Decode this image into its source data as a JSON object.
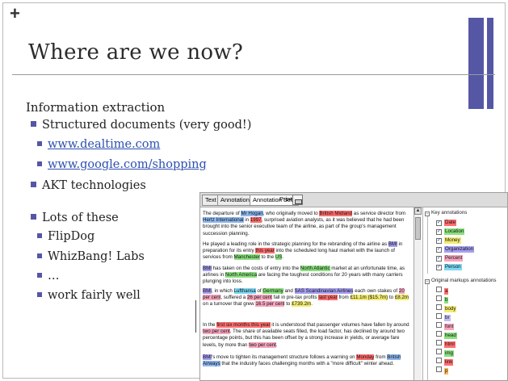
{
  "slide": {
    "plus": "+",
    "title": "Where are we now?",
    "section": "Information extraction",
    "accent_color": "#5557a5",
    "bullets": [
      {
        "text": "Structured documents (very good!)"
      },
      {
        "text": "www.dealtime.com",
        "link": true
      },
      {
        "text": "www.google.com/shopping",
        "link": true
      },
      {
        "text": "AKT technologies"
      },
      {
        "text": "Lots of these"
      },
      {
        "text": "FlipDog"
      },
      {
        "text": "WhizBang! Labs"
      },
      {
        "text": "…"
      },
      {
        "text": "work fairly well"
      }
    ]
  },
  "app": {
    "tabs": [
      "Text",
      "Annotations",
      "Annotation Sets",
      "Print"
    ],
    "printer_icon": "printer-icon",
    "paragraphs": [
      {
        "segments": [
          {
            "t": "The departure of "
          },
          {
            "t": "Mr Hogan",
            "c": "blue"
          },
          {
            "t": ", who originally moved to "
          },
          {
            "t": "British Midland",
            "c": "red"
          },
          {
            "t": " as service director from "
          },
          {
            "t": "Hertz International",
            "c": "blue"
          },
          {
            "t": " in "
          },
          {
            "t": "1997",
            "c": "red"
          },
          {
            "t": ", surprised aviation analysts, as it was believed that he had been brought into the senior executive team of the airline, as part of the group's management succession planning."
          }
        ]
      },
      {
        "segments": [
          {
            "t": "He played a leading role in the strategic planning for the rebranding of the airline as "
          },
          {
            "t": "BMI",
            "c": "violet"
          },
          {
            "t": " in preparation for its entry "
          },
          {
            "t": "this year",
            "c": "red"
          },
          {
            "t": " into the scheduled long haul market with the launch of services from "
          },
          {
            "t": "Manchester",
            "c": "green"
          },
          {
            "t": " to the "
          },
          {
            "t": "US",
            "c": "green"
          },
          {
            "t": "."
          }
        ]
      },
      {
        "segments": [
          {
            "t": "BMI",
            "c": "violet"
          },
          {
            "t": " has taken on the costs of entry into the "
          },
          {
            "t": "North Atlantic",
            "c": "green"
          },
          {
            "t": " market at an unfortunate time, as airlines in "
          },
          {
            "t": "North America",
            "c": "green"
          },
          {
            "t": " are facing the toughest conditions for 20 years with many carriers plunging into loss."
          }
        ]
      },
      {
        "segments": [
          {
            "t": "BMI",
            "c": "violet"
          },
          {
            "t": ", in which "
          },
          {
            "t": "Lufthansa",
            "c": "cyan"
          },
          {
            "t": " of "
          },
          {
            "t": "Germany",
            "c": "green"
          },
          {
            "t": " and "
          },
          {
            "t": "SAS Scandinavian Airlines",
            "c": "violet"
          },
          {
            "t": " each own stakes of "
          },
          {
            "t": "20 per cent",
            "c": "pink"
          },
          {
            "t": ", suffered a "
          },
          {
            "t": "26 per cent",
            "c": "pink"
          },
          {
            "t": " fall in pre-tax profits "
          },
          {
            "t": "last year",
            "c": "red"
          },
          {
            "t": " from "
          },
          {
            "t": "£11.1m ($15.7m)",
            "c": "yellow"
          },
          {
            "t": " to "
          },
          {
            "t": "£8.2m",
            "c": "yellow"
          },
          {
            "t": " on a turnover that grew "
          },
          {
            "t": "16.5 per cent",
            "c": "pink"
          },
          {
            "t": " to "
          },
          {
            "t": "£739.2m",
            "c": "yellow"
          },
          {
            "t": "."
          }
        ]
      },
      {
        "segments": [
          {
            "t": "In the "
          },
          {
            "t": "first six months this year",
            "c": "red"
          },
          {
            "t": " it is understood that passenger volumes have fallen by around "
          },
          {
            "t": "two per cent",
            "c": "pink"
          },
          {
            "t": ". The share of available seats filled, the load factor, has declined by around two percentage points, but this has been offset by a strong increase in yields, or average fare levels, by more than "
          },
          {
            "t": "two per cent",
            "c": "pink"
          },
          {
            "t": "."
          }
        ]
      },
      {
        "segments": [
          {
            "t": "BMI",
            "c": "violet"
          },
          {
            "t": "'s move to tighten its management structure follows a warning on "
          },
          {
            "t": "Monday",
            "c": "red"
          },
          {
            "t": " from "
          },
          {
            "t": "British Airways",
            "c": "blue"
          },
          {
            "t": " that the industry faces challenging months with a \"more difficult\" winter ahead."
          }
        ]
      }
    ],
    "tree": {
      "key_label": "Key annotations",
      "key_items": [
        {
          "label": "Date",
          "color": "#ff6f6f"
        },
        {
          "label": "Location",
          "color": "#8be07f"
        },
        {
          "label": "Money",
          "color": "#f3ec74"
        },
        {
          "label": "Organization",
          "color": "#a6a0f0"
        },
        {
          "label": "Percent",
          "color": "#f6a6bd"
        },
        {
          "label": "Person",
          "color": "#7fd8f4"
        }
      ],
      "orig_label": "Original markups annotations",
      "orig_items": [
        {
          "label": "a",
          "color": "#ff6f6f"
        },
        {
          "label": "b",
          "color": "#8be07f"
        },
        {
          "label": "body",
          "color": "#f3ec74"
        },
        {
          "label": "br",
          "color": "#c4bdf2"
        },
        {
          "label": "font",
          "color": "#f6a6bd"
        },
        {
          "label": "head",
          "color": "#8be07f"
        },
        {
          "label": "html",
          "color": "#ff6f6f"
        },
        {
          "label": "img",
          "color": "#8be07f"
        },
        {
          "label": "link",
          "color": "#ff6f6f"
        },
        {
          "label": "p",
          "color": "#f7b85f"
        }
      ]
    }
  }
}
